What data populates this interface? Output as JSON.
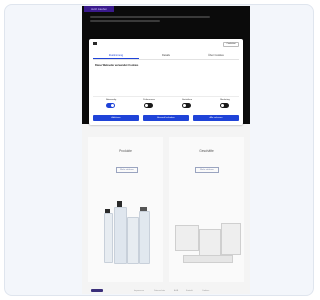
{
  "site": {
    "top_button": "Jetzt kaufen",
    "hero_lines": []
  },
  "sections": [
    {
      "title": "Produkte",
      "text": "",
      "link": "Mehr erfahren"
    },
    {
      "title": "Geschäfte",
      "text": "",
      "link": "Mehr erfahren"
    }
  ],
  "footer": {
    "links": [
      "Impressum",
      "Datenschutz",
      "AGB",
      "Kontakt",
      "Cookies"
    ],
    "copyright": ""
  },
  "consent": {
    "badge": "Cookiebot",
    "tabs": [
      "Zustimmung",
      "Details",
      "Über Cookies"
    ],
    "active_tab_index": 0,
    "title": "Diese Webseite verwendet Cookies",
    "body": "",
    "toggles": [
      {
        "label": "Notwendig",
        "state": "on"
      },
      {
        "label": "Präferenzen",
        "state": "off"
      },
      {
        "label": "Statistiken",
        "state": "off"
      },
      {
        "label": "Marketing",
        "state": "off"
      }
    ],
    "buttons": [
      "Ablehnen",
      "Auswahl erlauben",
      "Alle zulassen"
    ]
  }
}
